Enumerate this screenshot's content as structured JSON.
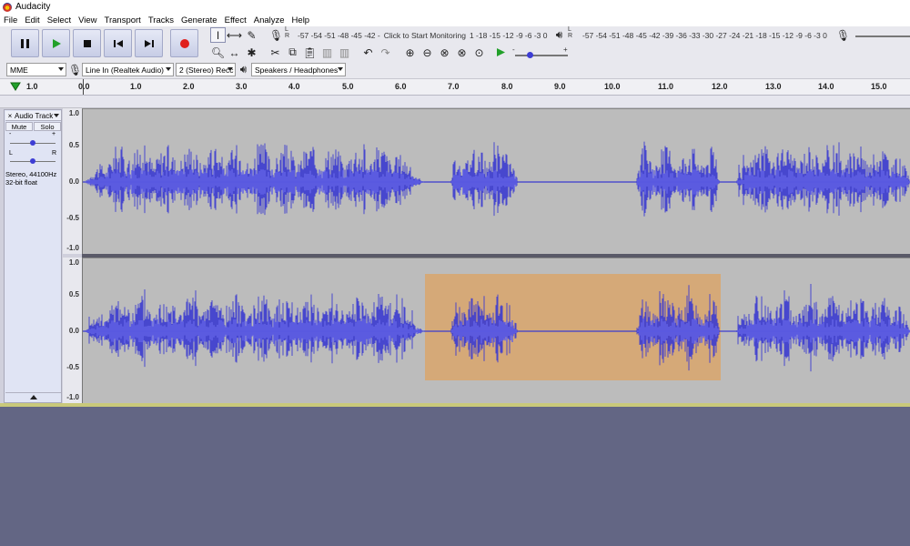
{
  "window": {
    "title": "Audacity"
  },
  "menu": [
    "File",
    "Edit",
    "Select",
    "View",
    "Transport",
    "Tracks",
    "Generate",
    "Effect",
    "Analyze",
    "Help"
  ],
  "transport": {
    "pause": "pause-icon",
    "play": "play-icon",
    "stop": "stop-icon",
    "skip_start": "skip-to-start-icon",
    "skip_end": "skip-to-end-icon",
    "record": "record-icon"
  },
  "meters": {
    "record_scale": "-57 -54 -51 -48 -45 -42 -",
    "record_hint": "Click to Start Monitoring",
    "record_scale_right": "1 -18 -15 -12 -9 -6 -3 0",
    "playback_scale": "-57 -54 -51 -48 -45 -42 -39 -36 -33 -30 -27 -24 -21 -18 -15 -12 -9 -6 -3 0",
    "lr_top": "L",
    "lr_bottom": "R"
  },
  "gain": {
    "minus": "-",
    "plus": "+"
  },
  "devices": {
    "host": "MME",
    "input": "Line In (Realtek Audio)",
    "channels": "2 (Stereo) Recc",
    "output": "Speakers / Headphones"
  },
  "ruler": {
    "ticks": [
      "1.0",
      "0.0",
      "1.0",
      "2.0",
      "3.0",
      "4.0",
      "5.0",
      "6.0",
      "7.0",
      "8.0",
      "9.0",
      "10.0",
      "11.0",
      "12.0",
      "13.0",
      "14.0",
      "15.0"
    ]
  },
  "track": {
    "name": "Audio Track",
    "close": "×",
    "mute": "Mute",
    "solo": "Solo",
    "gain_minus": "-",
    "gain_plus": "+",
    "pan_left": "L",
    "pan_right": "R",
    "info_line1": "Stereo, 44100Hz",
    "info_line2": "32-bit float",
    "scale": [
      "1.0",
      "0.5",
      "0.0",
      "-0.5",
      "-1.0"
    ],
    "waveform_color": "#3b3bd0",
    "selection_color": "#d9a66c"
  },
  "colors": {
    "background": "#636684",
    "wave_bg": "#bcbcbc",
    "accent": "#3d3dd4",
    "record": "#e0201c",
    "play": "#22a02a"
  }
}
